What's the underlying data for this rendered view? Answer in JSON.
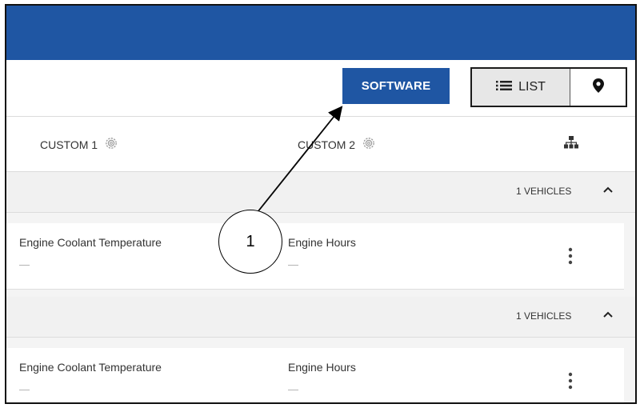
{
  "toolbar": {
    "software_label": "SOFTWARE",
    "list_label": "LIST"
  },
  "columns": {
    "custom1": "CUSTOM 1",
    "custom2": "CUSTOM 2"
  },
  "groups": [
    {
      "vehicle_count": "1 VEHICLES",
      "card": {
        "field1_label": "Engine Coolant Temperature",
        "field1_value": "—",
        "field2_label": "Engine Hours",
        "field2_value": "—"
      }
    },
    {
      "vehicle_count": "1 VEHICLES",
      "card": {
        "field1_label": "Engine Coolant Temperature",
        "field1_value": "—",
        "field2_label": "Engine Hours",
        "field2_value": "—"
      }
    }
  ],
  "callout": {
    "number": "1"
  },
  "colors": {
    "brand": "#1f56a3"
  },
  "icons": [
    "list-icon",
    "map-pin-icon",
    "gear-icon",
    "hierarchy-icon",
    "chevron-up-icon",
    "kebab-menu-icon"
  ]
}
